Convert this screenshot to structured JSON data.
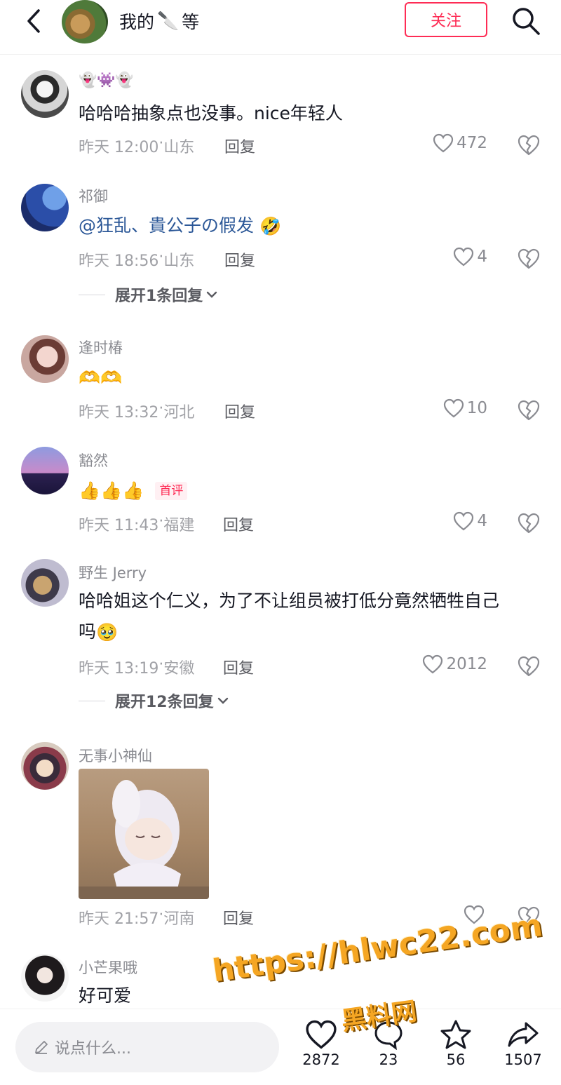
{
  "header": {
    "title_prefix": "我的",
    "title_suffix": "等",
    "knife_emoji": "🔪",
    "follow_label": "关注"
  },
  "comments": [
    {
      "username": "👻👾👻",
      "text": "哈哈哈抽象点也没事。nice年轻人",
      "time": "昨天 12:00",
      "location": "山东",
      "reply_label": "回复",
      "likes": "472"
    },
    {
      "username": "祁御",
      "mention": "@狂乱、貴公子の假发",
      "emoji": "🤣",
      "time": "昨天 18:56",
      "location": "山东",
      "reply_label": "回复",
      "likes": "4",
      "expand_label": "展开1条回复"
    },
    {
      "username": "逢时椿",
      "emoji": "🫶🫶",
      "time": "昨天 13:32",
      "location": "河北",
      "reply_label": "回复",
      "likes": "10"
    },
    {
      "username": "豁然",
      "emoji": "👍👍👍",
      "badge": "首评",
      "time": "昨天 11:43",
      "location": "福建",
      "reply_label": "回复",
      "likes": "4"
    },
    {
      "username": "野生 Jerry",
      "text_line1": "哈哈姐这个仁义，为了不让组员被打低分竟然牺牲自己",
      "text_line2": "吗",
      "emoji": "🥹",
      "time": "昨天 13:19",
      "location": "安徽",
      "reply_label": "回复",
      "likes": "2012",
      "expand_label": "展开12条回复"
    },
    {
      "username": "无事小神仙",
      "time": "昨天 21:57",
      "location": "河南",
      "reply_label": "回复",
      "likes": ""
    },
    {
      "username": "小芒果哦",
      "text": "好可爱"
    }
  ],
  "bottom_bar": {
    "input_placeholder": "说点什么...",
    "like_count": "2872",
    "comment_count": "23",
    "favorite_count": "56",
    "share_count": "1507"
  },
  "watermark": {
    "url": "https://hlwc22.com",
    "name": "黑料网"
  },
  "colors": {
    "accent": "#fe2c55",
    "mention": "#2b5797",
    "watermark": "#f5a623"
  }
}
